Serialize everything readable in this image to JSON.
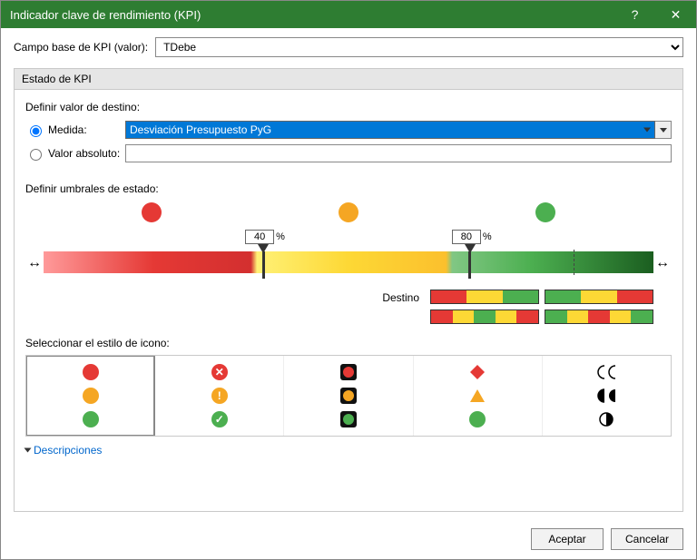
{
  "title": "Indicador clave de rendimiento (KPI)",
  "baseFieldLabel": "Campo base de KPI (valor):",
  "baseFieldValue": "TDebe",
  "section": {
    "header": "Estado de KPI",
    "defineTarget": "Definir valor de destino:",
    "measureLabel": "Medida:",
    "measureValue": "Desviación Presupuesto PyG",
    "absLabel": "Valor absoluto:",
    "absValue": "",
    "defineThresholds": "Definir umbrales de estado:",
    "threshold1": "40",
    "threshold2": "80",
    "pct": "%",
    "destino": "Destino",
    "iconStyleLabel": "Seleccionar el estilo de icono:",
    "descLink": "Descripciones"
  },
  "footer": {
    "ok": "Aceptar",
    "cancel": "Cancelar"
  }
}
